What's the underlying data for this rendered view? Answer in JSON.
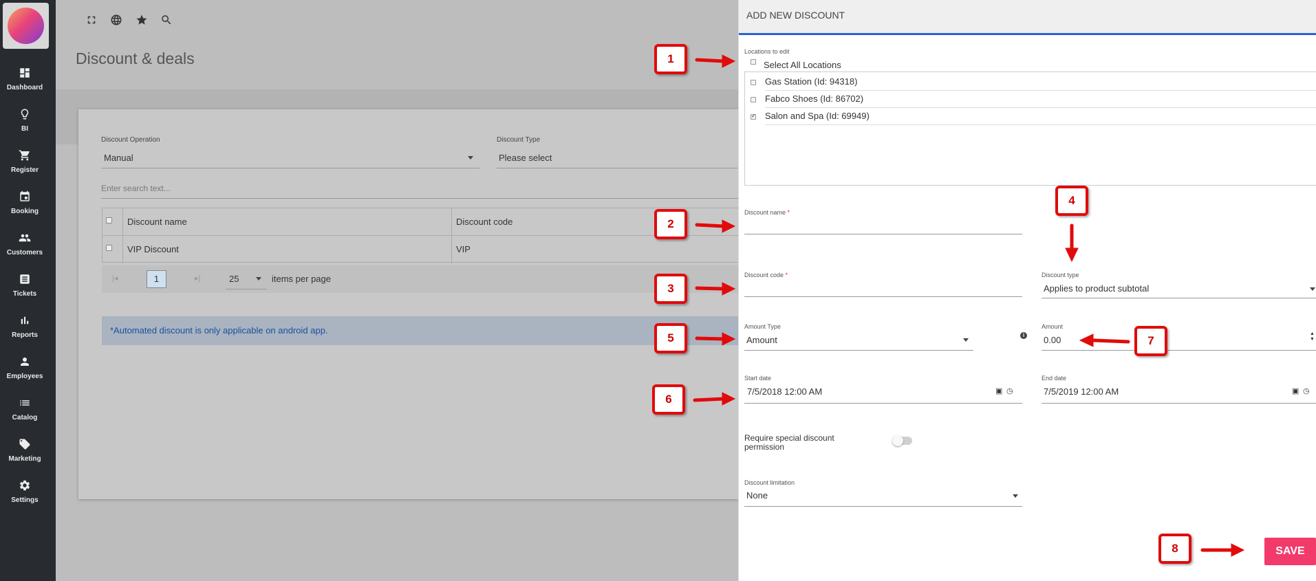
{
  "sidebar": {
    "items": [
      {
        "label": "Dashboard",
        "icon": "dashboard-icon"
      },
      {
        "label": "BI",
        "icon": "lightbulb-icon"
      },
      {
        "label": "Register",
        "icon": "cart-icon"
      },
      {
        "label": "Booking",
        "icon": "calendar-icon"
      },
      {
        "label": "Customers",
        "icon": "people-icon"
      },
      {
        "label": "Tickets",
        "icon": "tickets-icon"
      },
      {
        "label": "Reports",
        "icon": "bar-chart-icon"
      },
      {
        "label": "Employees",
        "icon": "person-icon"
      },
      {
        "label": "Catalog",
        "icon": "list-icon"
      },
      {
        "label": "Marketing",
        "icon": "tag-icon"
      },
      {
        "label": "Settings",
        "icon": "gear-icon"
      }
    ]
  },
  "page": {
    "title": "Discount & deals",
    "filters": {
      "operation_label": "Discount Operation",
      "operation_value": "Manual",
      "type_label": "Discount Type",
      "type_value": "Please select",
      "search_placeholder": "Enter search text..."
    },
    "table": {
      "headers": [
        "Discount name",
        "Discount code"
      ],
      "rows": [
        {
          "name": "VIP Discount",
          "code": "VIP"
        }
      ]
    },
    "pager": {
      "page": "1",
      "per_page": "25",
      "per_page_label": "items per page"
    },
    "info": "*Automated discount is only applicable on android app."
  },
  "drawer": {
    "title": "ADD NEW DISCOUNT",
    "locations_label": "Locations to edit",
    "select_all_label": "Select All Locations",
    "locations": [
      {
        "label": "Gas Station (Id: 94318)",
        "checked": false
      },
      {
        "label": "Fabco Shoes (Id: 86702)",
        "checked": false
      },
      {
        "label": "Salon and Spa (Id: 69949)",
        "checked": true
      }
    ],
    "discount_name_label": "Discount name",
    "discount_name_value": "",
    "discount_code_label": "Discount code",
    "discount_code_value": "",
    "required_mark": "*",
    "discount_type_label": "Discount type",
    "discount_type_value": "Applies to product subtotal",
    "amount_type_label": "Amount Type",
    "amount_type_value": "Amount",
    "amount_label": "Amount",
    "amount_value": "0.00",
    "start_date_label": "Start date",
    "start_date_value": "7/5/2018 12:00 AM",
    "end_date_label": "End date",
    "end_date_value": "7/5/2019 12:00 AM",
    "permission_label": "Require special discount permission",
    "permission_enabled": false,
    "limitation_label": "Discount limitation",
    "limitation_value": "None",
    "save_label": "SAVE"
  },
  "callouts": [
    "1",
    "2",
    "3",
    "4",
    "5",
    "6",
    "7",
    "8"
  ],
  "colors": {
    "sidebar_bg": "#282c30",
    "accent_blue": "#2b63d6",
    "save_pink": "#f23a6b",
    "callout_red": "#e10b0b"
  }
}
